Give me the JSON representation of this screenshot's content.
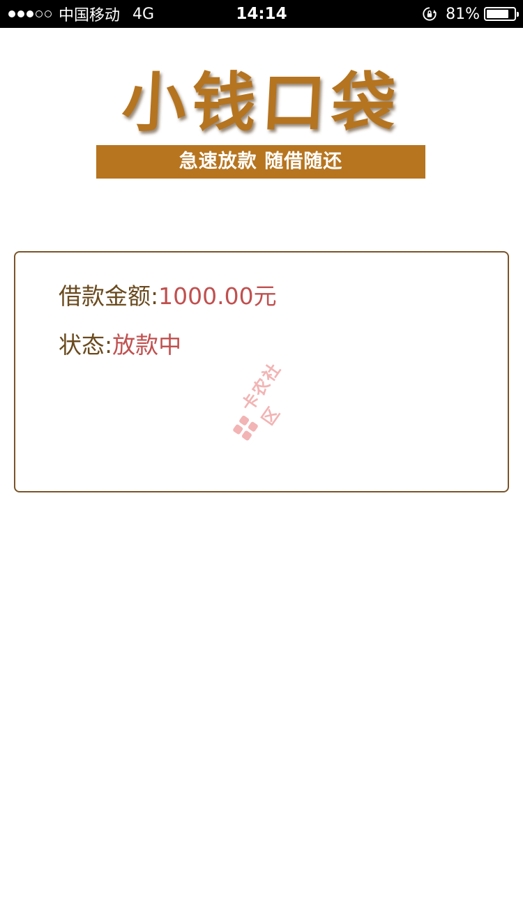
{
  "status_bar": {
    "carrier": "中国移动",
    "network": "4G",
    "time": "14:14",
    "battery_percent": "81%",
    "battery_level": 0.81,
    "signal_strength": 3,
    "signal_max": 5,
    "icons": [
      "signal-dots",
      "rotation-lock-icon",
      "battery-icon"
    ]
  },
  "header": {
    "app_name": "小钱口袋",
    "slogan": "急速放款   随借随还"
  },
  "loan_card": {
    "amount_label": "借款金额:",
    "amount_value": "1000.00元",
    "status_label": "状态:",
    "status_value": "放款中"
  },
  "watermark": {
    "text": "卡农社区",
    "icon": "flower-logo-icon"
  },
  "colors": {
    "brand": "#b77520",
    "label": "#6a4a1e",
    "value": "#c0504f",
    "card_border": "#7a5428",
    "watermark": "#e97878"
  }
}
